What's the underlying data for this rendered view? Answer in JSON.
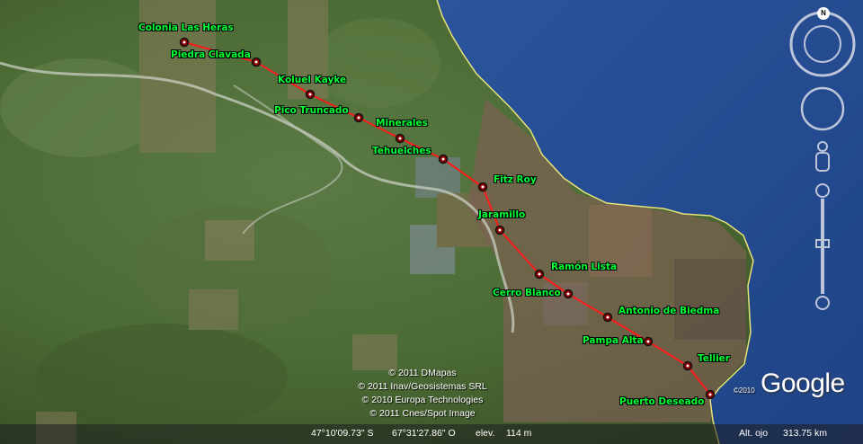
{
  "map": {
    "stops": [
      {
        "name": "Colonia Las Heras"
      },
      {
        "name": "Piedra Clavada"
      },
      {
        "name": "Koluel Kayke"
      },
      {
        "name": "Pico Truncado"
      },
      {
        "name": "Minerales"
      },
      {
        "name": "Tehuelches"
      },
      {
        "name": "Fitz Roy"
      },
      {
        "name": "Jaramillo"
      },
      {
        "name": "Ramón Lista"
      },
      {
        "name": "Cerro Blanco"
      },
      {
        "name": "Antonio de Biedma"
      },
      {
        "name": "Pampa Alta"
      },
      {
        "name": "Tellier"
      },
      {
        "name": "Puerto Deseado"
      }
    ],
    "route_color": "#ff1a1a",
    "label_color": "#00ff33",
    "water_color": "#2a4f9a",
    "land_color": "#4b6a34"
  },
  "credits": [
    "© 2011 DMapas",
    "© 2011 Inav/Geosistemas SRL",
    "© 2010 Europa Technologies",
    "© 2011 Cnes/Spot Image"
  ],
  "status": {
    "latitude": "47°10'09.73\" S",
    "longitude": "67°31'27.86\" O",
    "elevation_label": "elev.",
    "elevation": "114 m",
    "eye_alt_label": "Alt. ojo",
    "eye_alt": "313.75 km"
  },
  "branding": {
    "logo": "Google",
    "year": "©2010"
  },
  "navigation": {
    "north": "N",
    "icons": [
      "compass-ring-icon",
      "look-joystick-icon",
      "street-view-pegman-icon",
      "zoom-slider-icon"
    ]
  }
}
